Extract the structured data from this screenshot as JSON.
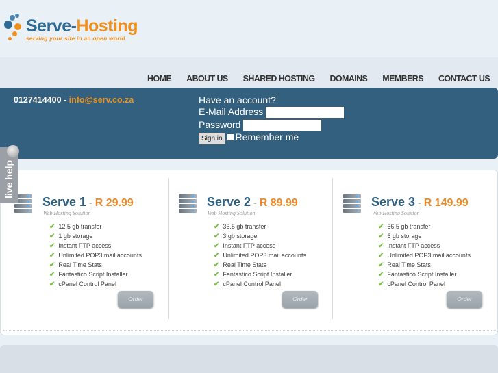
{
  "logo": {
    "name_a": "Serve-",
    "name_b": "Hosting",
    "tagline": "serving your site in an open world"
  },
  "nav": [
    "HOME",
    "ABOUT US",
    "SHARED HOSTING",
    "DOMAINS",
    "MEMBERS",
    "CONTACT US"
  ],
  "contact": {
    "phone": "0127414400",
    "sep": " - ",
    "email": "info@serv.co.za"
  },
  "login": {
    "heading": "Have an account?",
    "email_label": "E-Mail Address",
    "password_label": "Password",
    "signin": "Sign in",
    "remember": "Remember me",
    "email_value": "",
    "password_value": ""
  },
  "livehelp": "live help",
  "plans": [
    {
      "name": "Serve 1",
      "dash": "-",
      "price": "R 29.99",
      "subtitle": "Web Hosting Solution",
      "features": [
        "12.5 gb transfer",
        "1 gb storage",
        "Instant FTP access",
        "Unlimited POP3 mail accounts",
        "Real Time Stats",
        "Fantastico Script Installer",
        "cPanel Control Panel"
      ],
      "order": "Order"
    },
    {
      "name": "Serve 2",
      "dash": "-",
      "price": "R 89.99",
      "subtitle": "Web Hosting Solution",
      "features": [
        "36.5 gb transfer",
        "3 gb storage",
        "Instant FTP access",
        "Unlimited POP3 mail accounts",
        "Real Time Stats",
        "Fantastico Script Installer",
        "cPanel Control Panel"
      ],
      "order": "Order"
    },
    {
      "name": "Serve 3",
      "dash": "-",
      "price": "R 149.99",
      "subtitle": "Web Hosting Solution",
      "features": [
        "66.5 gb transfer",
        "5 gb storage",
        "Instant FTP access",
        "Unlimited POP3 mail accounts",
        "Real Time Stats",
        "Fantastico Script Installer",
        "cPanel Control Panel"
      ],
      "order": "Order"
    }
  ]
}
